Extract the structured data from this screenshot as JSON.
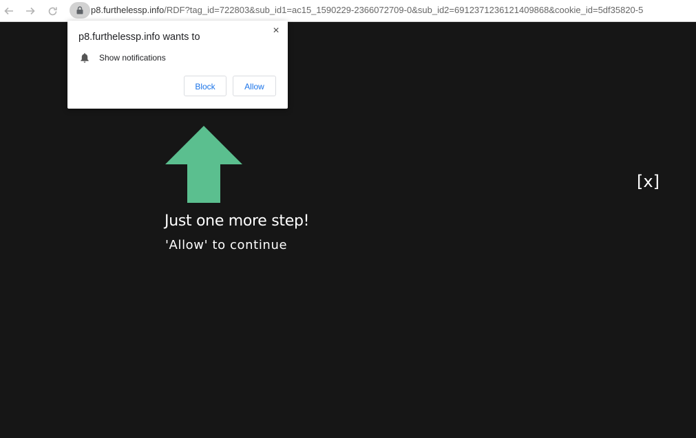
{
  "browser": {
    "url_host": "p8.furthelessp.info",
    "url_path": "/RDF?tag_id=722803&sub_id1=ac15_1590229-2366072709-0&sub_id2=6912371236121409868&cookie_id=5df35820-5",
    "icons": {
      "back": "back-arrow-icon",
      "forward": "forward-arrow-icon",
      "reload": "reload-icon",
      "lock": "lock-icon"
    }
  },
  "popup": {
    "title": "p8.furthelessp.info wants to",
    "permission_text": "Show notifications",
    "block_label": "Block",
    "allow_label": "Allow",
    "close_label": "×",
    "accent_color": "#1a73e8"
  },
  "page": {
    "headline": "Just one more step!",
    "subline": "'Allow' to continue",
    "close_label": "[x]",
    "arrow_color": "#5bbf8f",
    "background": "#161616"
  }
}
